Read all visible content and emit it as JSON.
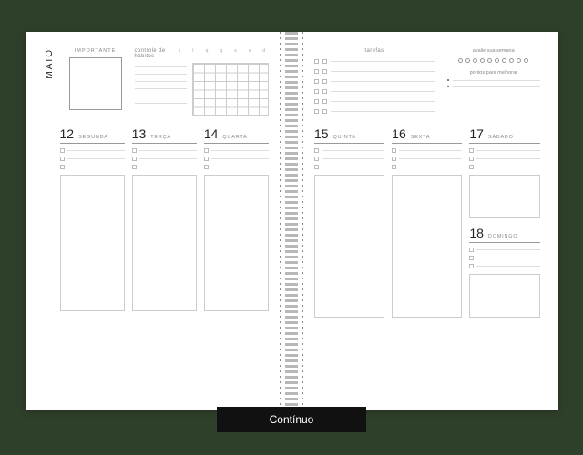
{
  "month": "Maio",
  "left_top": {
    "importante_label": "IMPORTANTE",
    "habitos_label": "controle de hábitos",
    "habit_days": [
      "s",
      "t",
      "q",
      "q",
      "s",
      "s",
      "d"
    ]
  },
  "right_top": {
    "tarefas_label": "tarefas",
    "avalie_label": "avalie sua semana",
    "pontos_label": "pontos para melhorar"
  },
  "days_left": [
    {
      "num": "12",
      "name": "SEGUNDA"
    },
    {
      "num": "13",
      "name": "TERÇA"
    },
    {
      "num": "14",
      "name": "QUARTA"
    }
  ],
  "days_right": [
    {
      "num": "15",
      "name": "QUINTA"
    },
    {
      "num": "16",
      "name": "SEXTA"
    }
  ],
  "weekend": [
    {
      "num": "17",
      "name": "SÁBADO"
    },
    {
      "num": "18",
      "name": "DOMINGO"
    }
  ],
  "footer": "Contínuo"
}
